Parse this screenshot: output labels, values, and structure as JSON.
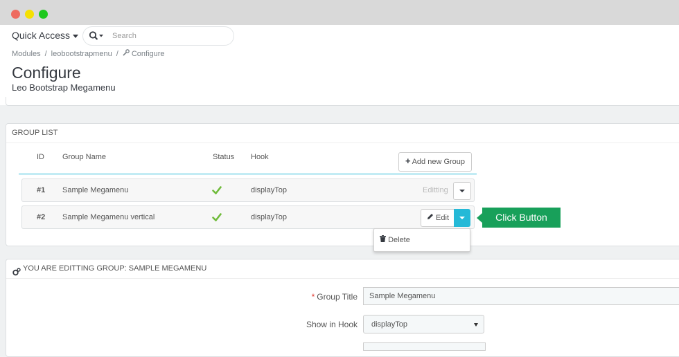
{
  "header": {
    "quick_access": "Quick Access",
    "search_placeholder": "Search",
    "breadcrumb": [
      "Modules",
      "leobootstrapmenu",
      "Configure"
    ],
    "title": "Configure",
    "subtitle": "Leo Bootstrap Megamenu"
  },
  "group_list": {
    "heading": "GROUP LIST",
    "columns": {
      "id": "ID",
      "name": "Group Name",
      "status": "Status",
      "hook": "Hook"
    },
    "add_button": "Add new Group",
    "rows": [
      {
        "id": "#1",
        "name": "Sample Megamenu",
        "hook": "displayTop",
        "state": "Editting"
      },
      {
        "id": "#2",
        "name": "Sample Megamenu vertical",
        "hook": "displayTop",
        "edit_label": "Edit"
      }
    ],
    "dropdown": {
      "delete_label": "Delete"
    }
  },
  "callout": {
    "text": "Click Button"
  },
  "edit_group": {
    "heading": "YOU ARE EDITTING GROUP: SAMPLE MEGAMENU",
    "title_label": "Group Title",
    "title_value": "Sample Megamenu",
    "hook_label": "Show in Hook",
    "hook_value": "displayTop"
  },
  "colors": {
    "accent": "#25b9d7",
    "callout": "#18a05a",
    "check": "#6fbb3a",
    "required": "#e0342b"
  }
}
